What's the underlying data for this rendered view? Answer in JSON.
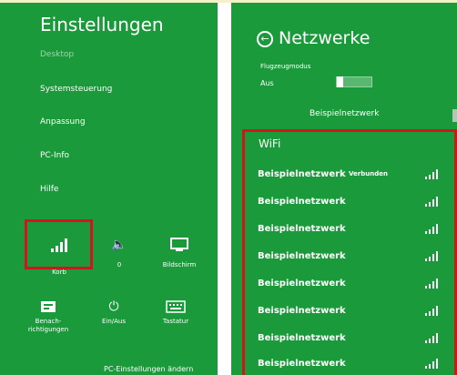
{
  "left_panel": {
    "title": "Einstellungen",
    "menu": [
      {
        "label": "Desktop",
        "dim": true
      },
      {
        "label": "Systemsteuerung"
      },
      {
        "label": "Anpassung"
      },
      {
        "label": "PC-Info"
      },
      {
        "label": "Hilfe"
      }
    ],
    "tiles": [
      {
        "icon": "wifi-signal-icon",
        "label": "Korb"
      },
      {
        "icon": "volume-icon",
        "label": "0"
      },
      {
        "icon": "screen-brightness-icon",
        "label": "Bildschirm"
      },
      {
        "icon": "notifications-icon",
        "label": "Benach-\nrichtigungen"
      },
      {
        "icon": "power-icon",
        "label": "Ein/Aus"
      },
      {
        "icon": "keyboard-icon",
        "label": "Tastatur"
      }
    ],
    "footer_link": "PC-Einstellungen ändern"
  },
  "right_panel": {
    "title": "Netzwerke",
    "airplane_mode_label": "Flugzeugmodus",
    "airplane_mode_value": "Aus",
    "top_network": "Beispielnetzwerk",
    "section_label": "WiFi",
    "networks": [
      {
        "name": "Beispielnetzwerk",
        "status": "Verbunden"
      },
      {
        "name": "Beispielnetzwerk",
        "status": ""
      },
      {
        "name": "Beispielnetzwerk",
        "status": ""
      },
      {
        "name": "Beispielnetzwerk",
        "status": ""
      },
      {
        "name": "Beispielnetzwerk",
        "status": ""
      },
      {
        "name": "Beispielnetzwerk",
        "status": ""
      },
      {
        "name": "Beispielnetzwerk",
        "status": ""
      },
      {
        "name": "Beispielnetzwerk",
        "status": ""
      }
    ]
  },
  "colors": {
    "panel_bg": "#1a9a3a",
    "highlight": "#d4141c",
    "text": "#ffffff"
  }
}
